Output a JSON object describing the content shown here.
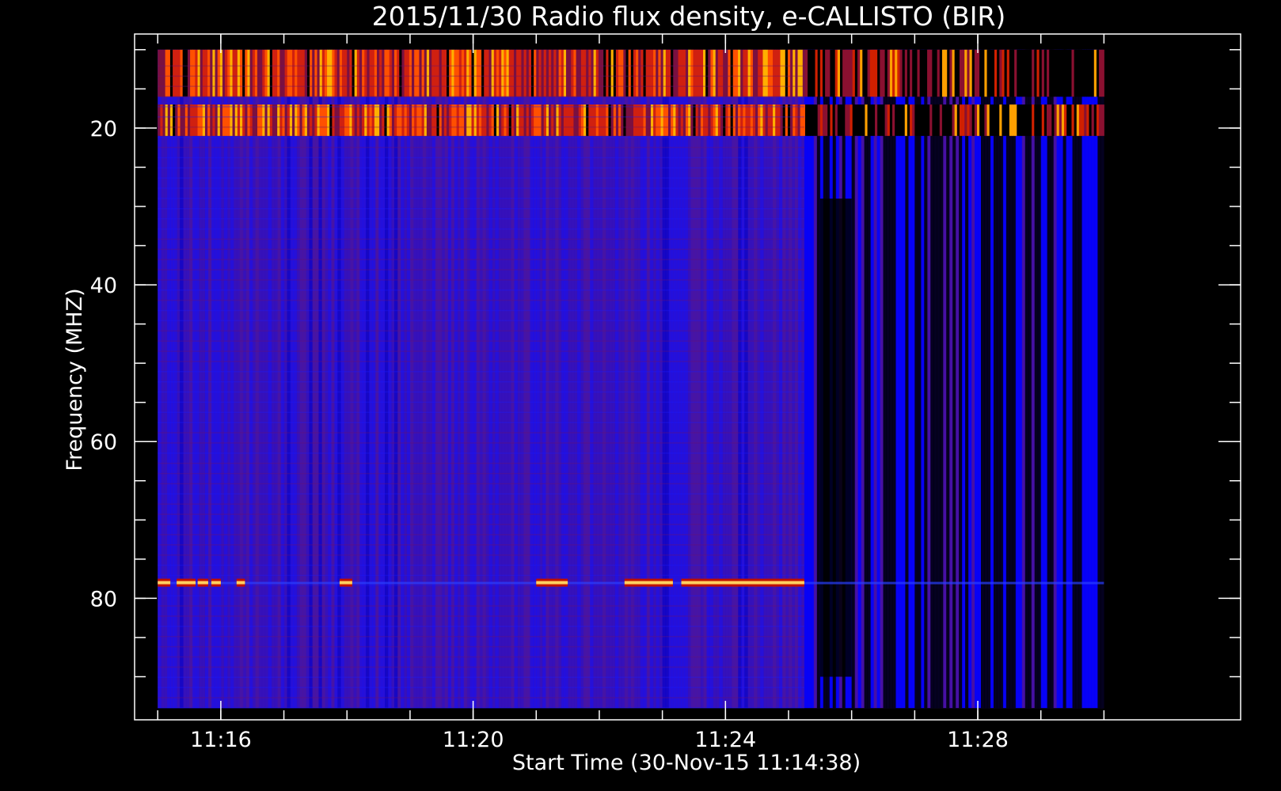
{
  "chart_data": {
    "type": "heatmap",
    "title": "2015/11/30  Radio flux density, e-CALLISTO (BIR)",
    "xlabel": "Start Time (30-Nov-15 11:14:38)",
    "ylabel": "Frequency (MHZ)",
    "x_start": "11:15:00",
    "x_end": "11:30:00",
    "xlim": [
      "11:14:38",
      "11:32:10"
    ],
    "ylim": [
      95.5,
      8.0
    ],
    "y_reversed": true,
    "data_extent_freq": [
      10,
      94
    ],
    "x_major_ticks": [
      "11:16",
      "11:20",
      "11:24",
      "11:28"
    ],
    "x_minor_ticks": [
      "11:15",
      "11:16",
      "11:17",
      "11:18",
      "11:19",
      "11:20",
      "11:21",
      "11:22",
      "11:23",
      "11:24",
      "11:25",
      "11:26",
      "11:27",
      "11:28",
      "11:29",
      "11:30"
    ],
    "y_major_ticks": [
      20,
      40,
      60,
      80
    ],
    "y_minor_ticks": [
      10,
      15,
      20,
      25,
      30,
      35,
      40,
      45,
      50,
      55,
      60,
      65,
      70,
      75,
      80,
      85,
      90
    ],
    "colormap": [
      "#000000",
      "#0000ff",
      "#5a1a8c",
      "#b01010",
      "#ff3000",
      "#ffd000"
    ],
    "background_level": "purple-blue",
    "bright_bands_mhz": [
      [
        10,
        16
      ],
      [
        17,
        21
      ]
    ],
    "interference_line": {
      "freq_mhz": 78,
      "segments": [
        [
          "11:15:00",
          "11:15:12"
        ],
        [
          "11:15:18",
          "11:15:36"
        ],
        [
          "11:15:38",
          "11:15:48"
        ],
        [
          "11:15:51",
          "11:16:00"
        ],
        [
          "11:16:15",
          "11:16:23"
        ],
        [
          "11:17:53",
          "11:18:05"
        ],
        [
          "11:21:00",
          "11:21:30"
        ],
        [
          "11:22:24",
          "11:23:10"
        ],
        [
          "11:23:18",
          "11:25:15"
        ]
      ]
    },
    "dark_region": [
      "11:25:15",
      "11:30:00"
    ]
  }
}
